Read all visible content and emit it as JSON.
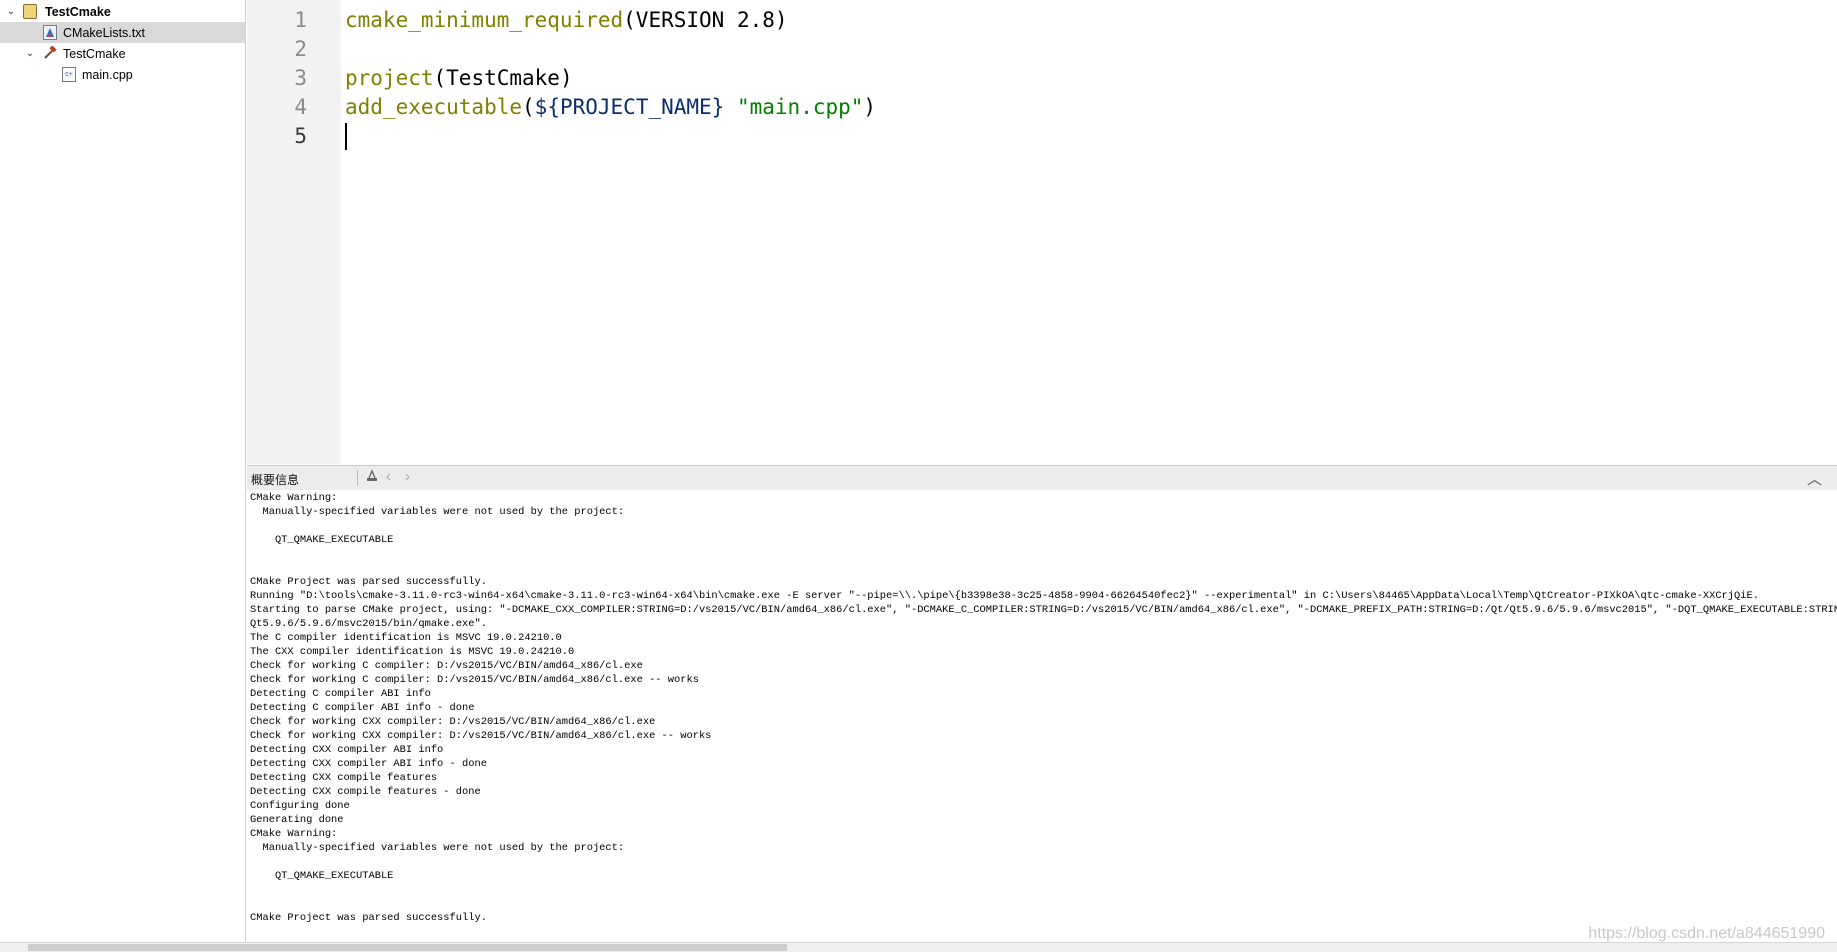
{
  "project_tree": {
    "items": [
      {
        "label": "TestCmake",
        "icon": "qtcreator-project-icon",
        "expanded": true
      },
      {
        "label": "CMakeLists.txt",
        "icon": "cmake-file-icon",
        "selected": true
      },
      {
        "label": "TestCmake",
        "icon": "hammer-target-icon",
        "expanded": true
      },
      {
        "label": "main.cpp",
        "icon": "cpp-file-icon"
      }
    ]
  },
  "editor": {
    "line_numbers": [
      "1",
      "2",
      "3",
      "4",
      "5"
    ],
    "current_line": "5",
    "lines": {
      "l1_cmd": "cmake_minimum_required",
      "l1_args": "(VERSION 2.8)",
      "l3_cmd": "project",
      "l3_args": "(TestCmake)",
      "l4_cmd": "add_executable",
      "l4_open": "(",
      "l4_var": "${PROJECT_NAME}",
      "l4_space": " ",
      "l4_str": "\"main.cpp\"",
      "l4_close": ")"
    }
  },
  "output_pane": {
    "title": "概要信息",
    "collapse_glyph": "︿",
    "lines": [
      "CMake Warning:",
      "  Manually-specified variables were not used by the project:",
      "",
      "    QT_QMAKE_EXECUTABLE",
      "",
      "",
      "CMake Project was parsed successfully.",
      "Running \"D:\\tools\\cmake-3.11.0-rc3-win64-x64\\cmake-3.11.0-rc3-win64-x64\\bin\\cmake.exe -E server \"--pipe=\\\\.\\pipe\\{b3398e38-3c25-4858-9904-66264540fec2}\" --experimental\" in C:\\Users\\84465\\AppData\\Local\\Temp\\QtCreator-PIXkOA\\qtc-cmake-XXCrjQiE.",
      "Starting to parse CMake project, using: \"-DCMAKE_CXX_COMPILER:STRING=D:/vs2015/VC/BIN/amd64_x86/cl.exe\", \"-DCMAKE_C_COMPILER:STRING=D:/vs2015/VC/BIN/amd64_x86/cl.exe\", \"-DCMAKE_PREFIX_PATH:STRING=D:/Qt/Qt5.9.6/5.9.6/msvc2015\", \"-DQT_QMAKE_EXECUTABLE:STRING=D:/Qt/",
      "Qt5.9.6/5.9.6/msvc2015/bin/qmake.exe\".",
      "The C compiler identification is MSVC 19.0.24210.0",
      "The CXX compiler identification is MSVC 19.0.24210.0",
      "Check for working C compiler: D:/vs2015/VC/BIN/amd64_x86/cl.exe",
      "Check for working C compiler: D:/vs2015/VC/BIN/amd64_x86/cl.exe -- works",
      "Detecting C compiler ABI info",
      "Detecting C compiler ABI info - done",
      "Check for working CXX compiler: D:/vs2015/VC/BIN/amd64_x86/cl.exe",
      "Check for working CXX compiler: D:/vs2015/VC/BIN/amd64_x86/cl.exe -- works",
      "Detecting CXX compiler ABI info",
      "Detecting CXX compiler ABI info - done",
      "Detecting CXX compile features",
      "Detecting CXX compile features - done",
      "Configuring done",
      "Generating done",
      "CMake Warning:",
      "  Manually-specified variables were not used by the project:",
      "",
      "    QT_QMAKE_EXECUTABLE",
      "",
      "",
      "CMake Project was parsed successfully."
    ]
  },
  "watermark": "https://blog.csdn.net/a844651990",
  "colors": {
    "cmake_command": "#808000",
    "variable": "#0b2e6c",
    "string": "#008000",
    "selection": "#d9d9d9",
    "gutter": "#f2f2f2"
  }
}
